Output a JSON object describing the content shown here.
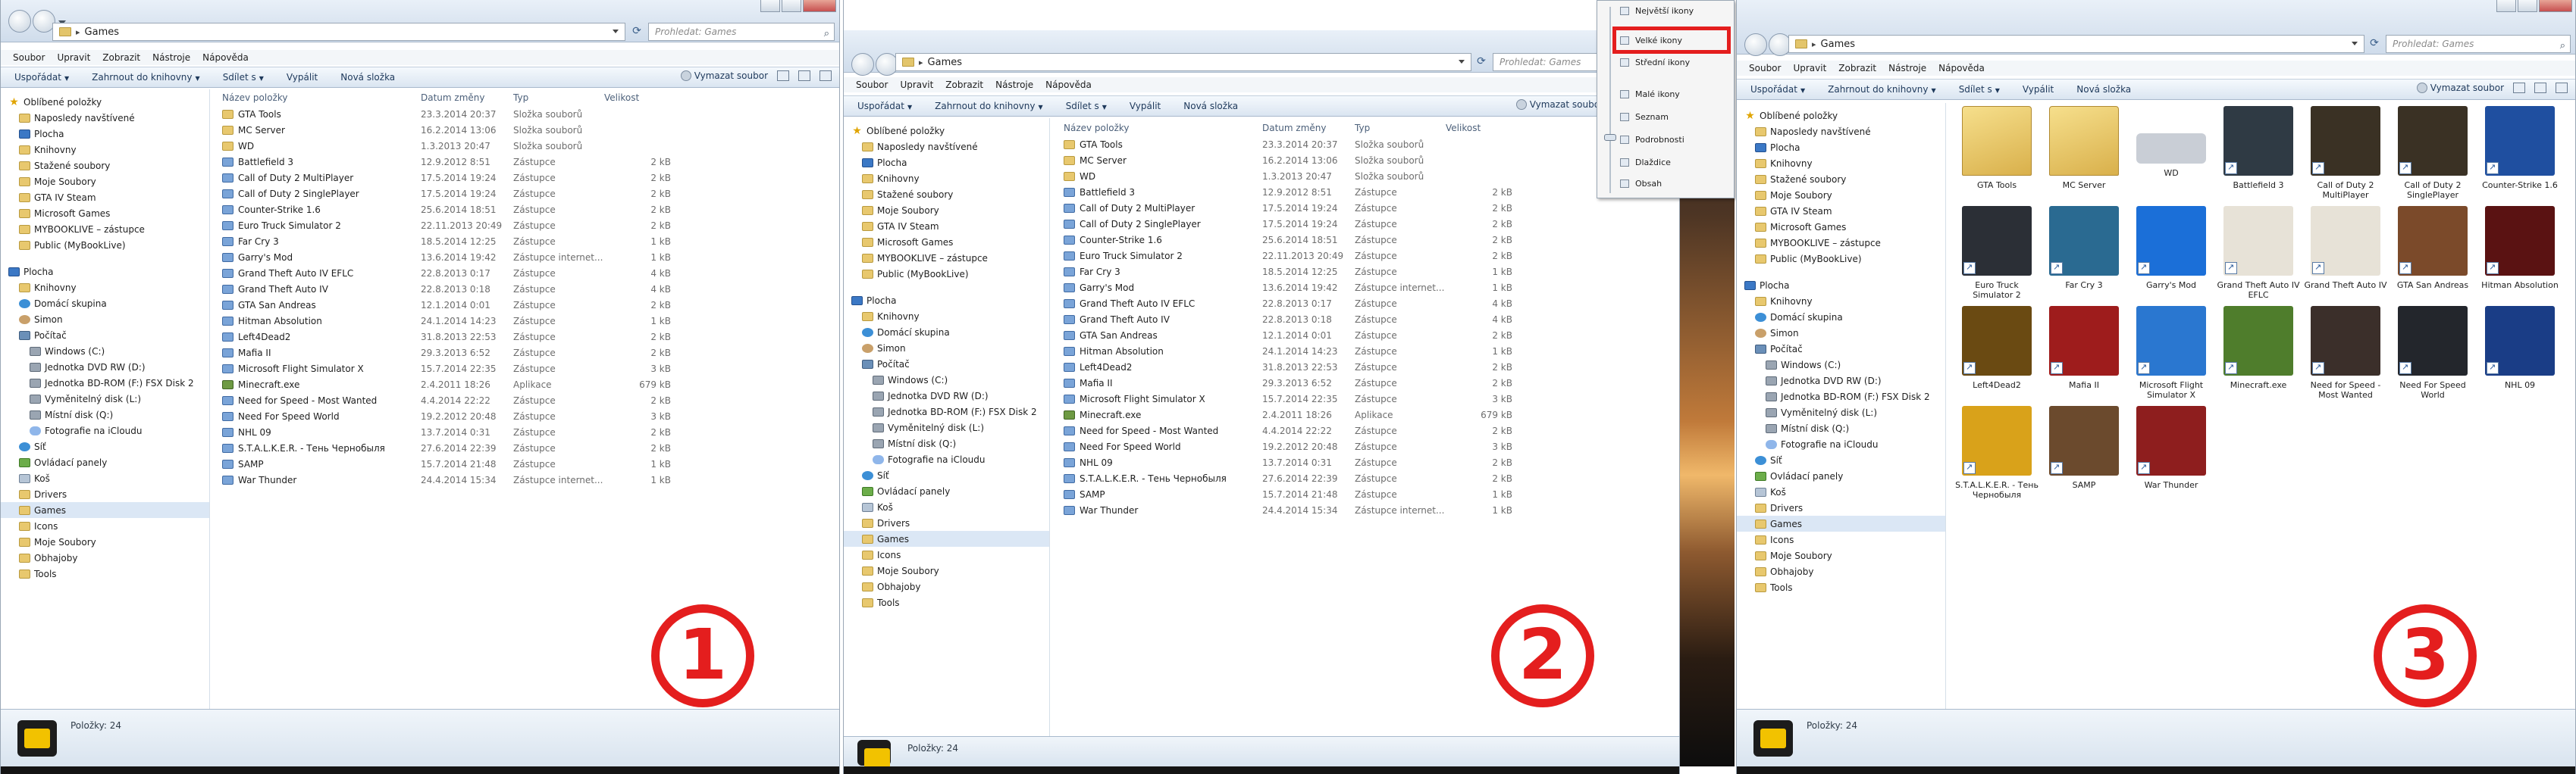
{
  "window": {
    "address_path": "Games",
    "search_placeholder": "Prohledat: Games",
    "menu": [
      "Soubor",
      "Upravit",
      "Zobrazit",
      "Nástroje",
      "Nápověda"
    ],
    "toolbar": {
      "organize": "Uspořádat",
      "include_in_library": "Zahrnout do knihovny",
      "share": "Sdílet s",
      "burn": "Vypálit",
      "new_folder": "Nová složka",
      "clear_library": "Vymazat soubor"
    },
    "columns": {
      "name": "Název položky",
      "date": "Datum změny",
      "type": "Typ",
      "size": "Velikost"
    },
    "status": "Položky: 24"
  },
  "nav_items": [
    {
      "label": "Oblíbené položky",
      "icon": "star-icon",
      "level": 0
    },
    {
      "label": "Naposledy navštívené",
      "icon": "folder-icon",
      "level": 1
    },
    {
      "label": "Plocha",
      "icon": "desktop-icon",
      "level": 1
    },
    {
      "label": "Knihovny",
      "icon": "folder-icon",
      "level": 1
    },
    {
      "label": "Stažené soubory",
      "icon": "folder-icon",
      "level": 1
    },
    {
      "label": "Moje Soubory",
      "icon": "folder-icon",
      "level": 1
    },
    {
      "label": "GTA IV Steam",
      "icon": "folder-icon",
      "level": 1
    },
    {
      "label": "Microsoft Games",
      "icon": "folder-icon",
      "level": 1
    },
    {
      "label": "MYBOOKLIVE – zástupce",
      "icon": "folder-icon",
      "level": 1
    },
    {
      "label": "Public (MyBookLive)",
      "icon": "folder-icon",
      "level": 1
    },
    {
      "label": "",
      "icon": "",
      "level": -1
    },
    {
      "label": "Plocha",
      "icon": "desktop-icon",
      "level": 0
    },
    {
      "label": "Knihovny",
      "icon": "folder-icon",
      "level": 1
    },
    {
      "label": "Domácí skupina",
      "icon": "net-icon",
      "level": 1
    },
    {
      "label": "Simon",
      "icon": "user-icon",
      "level": 1
    },
    {
      "label": "Počítač",
      "icon": "computer-icon",
      "level": 1
    },
    {
      "label": "Windows (C:)",
      "icon": "drive-icon",
      "level": 2
    },
    {
      "label": "Jednotka DVD RW (D:)",
      "icon": "drive-icon",
      "level": 2
    },
    {
      "label": "Jednotka BD-ROM (F:) FSX Disk 2",
      "icon": "drive-icon",
      "level": 2
    },
    {
      "label": "Vyměnitelný disk (L:)",
      "icon": "drive-icon",
      "level": 2
    },
    {
      "label": "Místní disk (Q:)",
      "icon": "drive-icon",
      "level": 2
    },
    {
      "label": "Fotografie na iCloudu",
      "icon": "cloud-icon",
      "level": 2
    },
    {
      "label": "Síť",
      "icon": "net-icon",
      "level": 1
    },
    {
      "label": "Ovládací panely",
      "icon": "control-panel-icon",
      "level": 1
    },
    {
      "label": "Koš",
      "icon": "recycle-bin-icon",
      "level": 1
    },
    {
      "label": "Drivers",
      "icon": "folder-icon",
      "level": 1
    },
    {
      "label": "Games",
      "icon": "folder-icon",
      "level": 1,
      "selected": true
    },
    {
      "label": "Icons",
      "icon": "folder-icon",
      "level": 1
    },
    {
      "label": "Moje Soubory",
      "icon": "folder-icon",
      "level": 1
    },
    {
      "label": "Obhajoby",
      "icon": "folder-icon",
      "level": 1
    },
    {
      "label": "Tools",
      "icon": "folder-icon",
      "level": 1
    }
  ],
  "files_left": [
    {
      "name": "GTA Tools",
      "date": "23.3.2014 20:37",
      "type": "Složka souborů",
      "size": "",
      "kind": "folder"
    },
    {
      "name": "MC Server",
      "date": "16.2.2014 13:06",
      "type": "Složka souborů",
      "size": "",
      "kind": "folder"
    },
    {
      "name": "WD",
      "date": "1.3.2013 20:47",
      "type": "Složka souborů",
      "size": "",
      "kind": "folder"
    },
    {
      "name": "Battlefield 3",
      "date": "12.9.2012 8:51",
      "type": "Zástupce",
      "size": "2 kB",
      "kind": "shortcut"
    },
    {
      "name": "Call of Duty 2 MultiPlayer",
      "date": "17.5.2014 19:24",
      "type": "Zástupce",
      "size": "2 kB",
      "kind": "shortcut"
    },
    {
      "name": "Call of Duty 2 SinglePlayer",
      "date": "17.5.2014 19:24",
      "type": "Zástupce",
      "size": "2 kB",
      "kind": "shortcut"
    },
    {
      "name": "Counter-Strike 1.6",
      "date": "25.6.2014 18:51",
      "type": "Zástupce",
      "size": "2 kB",
      "kind": "shortcut"
    },
    {
      "name": "Euro Truck Simulator 2",
      "date": "22.11.2013 20:49",
      "type": "Zástupce",
      "size": "2 kB",
      "kind": "shortcut"
    },
    {
      "name": "Far Cry 3",
      "date": "18.5.2014 12:25",
      "type": "Zástupce",
      "size": "1 kB",
      "kind": "shortcut"
    },
    {
      "name": "Garry's Mod",
      "date": "13.6.2014 19:42",
      "type": "Zástupce internet...",
      "size": "1 kB",
      "kind": "shortcut"
    },
    {
      "name": "Grand Theft Auto IV EFLC",
      "date": "22.8.2013 0:17",
      "type": "Zástupce",
      "size": "4 kB",
      "kind": "shortcut"
    },
    {
      "name": "Grand Theft Auto IV",
      "date": "22.8.2013 0:18",
      "type": "Zástupce",
      "size": "4 kB",
      "kind": "shortcut"
    },
    {
      "name": "GTA San Andreas",
      "date": "12.1.2014 0:01",
      "type": "Zástupce",
      "size": "2 kB",
      "kind": "shortcut"
    },
    {
      "name": "Hitman Absolution",
      "date": "24.1.2014 14:23",
      "type": "Zástupce",
      "size": "1 kB",
      "kind": "shortcut"
    },
    {
      "name": "Left4Dead2",
      "date": "31.8.2013 22:53",
      "type": "Zástupce",
      "size": "2 kB",
      "kind": "shortcut"
    },
    {
      "name": "Mafia II",
      "date": "29.3.2013 6:52",
      "type": "Zástupce",
      "size": "2 kB",
      "kind": "shortcut"
    },
    {
      "name": "Microsoft Flight Simulator X",
      "date": "15.7.2014 22:35",
      "type": "Zástupce",
      "size": "3 kB",
      "kind": "shortcut"
    },
    {
      "name": "Minecraft.exe",
      "date": "2.4.2011 18:26",
      "type": "Aplikace",
      "size": "679 kB",
      "kind": "app"
    },
    {
      "name": "Need for Speed - Most Wanted",
      "date": "4.4.2014 22:22",
      "type": "Zástupce",
      "size": "2 kB",
      "kind": "shortcut"
    },
    {
      "name": "Need For Speed World",
      "date": "19.2.2012 20:48",
      "type": "Zástupce",
      "size": "3 kB",
      "kind": "shortcut"
    },
    {
      "name": "NHL 09",
      "date": "13.7.2014 0:31",
      "type": "Zástupce",
      "size": "2 kB",
      "kind": "shortcut"
    },
    {
      "name": "S.T.A.L.K.E.R. - Тень Чернобыля",
      "date": "27.6.2014 22:39",
      "type": "Zástupce",
      "size": "2 kB",
      "kind": "shortcut"
    },
    {
      "name": "SAMP",
      "date": "15.7.2014 21:48",
      "type": "Zástupce",
      "size": "1 kB",
      "kind": "shortcut"
    },
    {
      "name": "War Thunder",
      "date": "24.4.2014 15:34",
      "type": "Zástupce internet...",
      "size": "1 kB",
      "kind": "shortcut"
    }
  ],
  "view_menu": {
    "items": [
      "Největší ikony",
      "Velké ikony",
      "Střední ikony",
      "Malé ikony",
      "Seznam",
      "Podrobnosti",
      "Dlaždice",
      "Obsah"
    ],
    "highlighted": "Velké ikony"
  },
  "tiles": [
    {
      "label": "GTA Tools",
      "kind": "folder",
      "color": "#e8c86e"
    },
    {
      "label": "MC Server",
      "kind": "folder",
      "color": "#e8c86e"
    },
    {
      "label": "WD",
      "kind": "drive",
      "color": "#c9ced6"
    },
    {
      "label": "Battlefield 3",
      "kind": "game",
      "color": "#2f3a44"
    },
    {
      "label": "Call of Duty 2 MultiPlayer",
      "kind": "game",
      "color": "#3a3124"
    },
    {
      "label": "Call of Duty 2 SinglePlayer",
      "kind": "game",
      "color": "#3a3124"
    },
    {
      "label": "Counter-Strike 1.6",
      "kind": "game",
      "color": "#1f4fa0"
    },
    {
      "label": "Euro Truck Simulator 2",
      "kind": "game",
      "color": "#2b2f36"
    },
    {
      "label": "Far Cry 3",
      "kind": "game",
      "color": "#2a6a91"
    },
    {
      "label": "Garry's Mod",
      "kind": "game",
      "color": "#1b6fd8"
    },
    {
      "label": "Grand Theft Auto IV EFLC",
      "kind": "game",
      "color": "#e7e2d7"
    },
    {
      "label": "Grand Theft Auto IV",
      "kind": "game",
      "color": "#e7e2d7"
    },
    {
      "label": "GTA San Andreas",
      "kind": "game",
      "color": "#7b4a2a"
    },
    {
      "label": "Hitman Absolution",
      "kind": "game",
      "color": "#5a1212"
    },
    {
      "label": "Left4Dead2",
      "kind": "game",
      "color": "#6a4a12"
    },
    {
      "label": "Mafia II",
      "kind": "game",
      "color": "#9e1c1c"
    },
    {
      "label": "Microsoft Flight Simulator X",
      "kind": "game",
      "color": "#2a77d0"
    },
    {
      "label": "Minecraft.exe",
      "kind": "game",
      "color": "#4f7d2c"
    },
    {
      "label": "Need for Speed - Most Wanted",
      "kind": "game",
      "color": "#3b2f2a"
    },
    {
      "label": "Need For Speed World",
      "kind": "game",
      "color": "#23262c"
    },
    {
      "label": "NHL 09",
      "kind": "game",
      "color": "#1a3d86"
    },
    {
      "label": "S.T.A.L.K.E.R. - Тень Чернобыля",
      "kind": "game",
      "color": "#d9a21a"
    },
    {
      "label": "SAMP",
      "kind": "game",
      "color": "#6b4a2d"
    },
    {
      "label": "War Thunder",
      "kind": "game",
      "color": "#8e1e1e"
    }
  ],
  "step_numbers": [
    "1",
    "2",
    "3"
  ],
  "accent": "#e41e1e"
}
